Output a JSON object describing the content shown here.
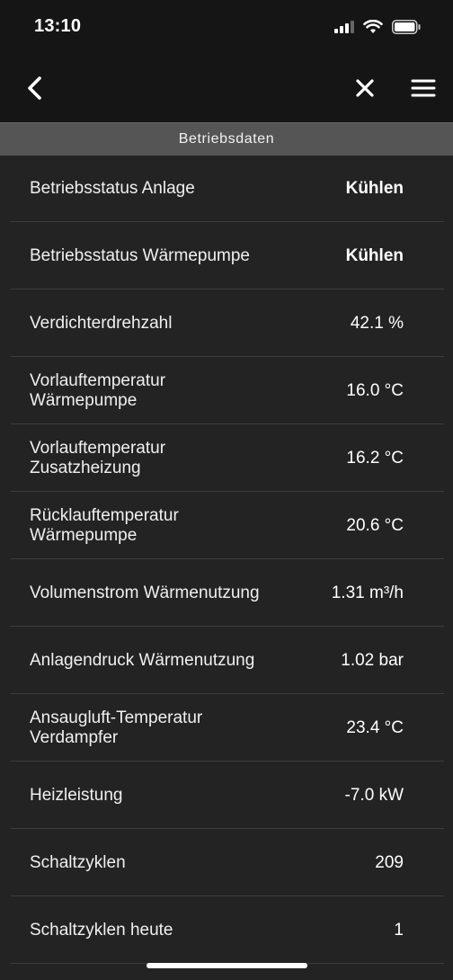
{
  "status_bar": {
    "time": "13:10",
    "icons": [
      "cellular-signal-icon",
      "wifi-icon",
      "battery-icon"
    ]
  },
  "nav": {
    "back_icon": "chevron-left-icon",
    "close_icon": "close-icon",
    "menu_icon": "hamburger-menu-icon"
  },
  "section": {
    "title": "Betriebsdaten"
  },
  "rows": [
    {
      "label": "Betriebsstatus Anlage",
      "value": "Kühlen",
      "bold": true
    },
    {
      "label": "Betriebsstatus Wärmepumpe",
      "value": "Kühlen",
      "bold": true
    },
    {
      "label": "Verdichterdrehzahl",
      "value": "42.1 %"
    },
    {
      "label": "Vorlauftemperatur\nWärmepumpe",
      "value": "16.0 °C"
    },
    {
      "label": "Vorlauftemperatur\nZusatzheizung",
      "value": "16.2 °C"
    },
    {
      "label": "Rücklauftemperatur\nWärmepumpe",
      "value": "20.6 °C"
    },
    {
      "label": "Volumenstrom Wärmenutzung",
      "value": "1.31 m³/h"
    },
    {
      "label": "Anlagendruck Wärmenutzung",
      "value": "1.02 bar"
    },
    {
      "label": "Ansaugluft-Temperatur\nVerdampfer",
      "value": "23.4 °C"
    },
    {
      "label": "Heizleistung",
      "value": "-7.0 kW"
    },
    {
      "label": "Schaltzyklen",
      "value": "209"
    },
    {
      "label": "Schaltzyklen heute",
      "value": "1"
    }
  ],
  "colors": {
    "background": "#232323",
    "bar": "#151515",
    "section_header": "#555555",
    "divider": "#3e3e3e",
    "text": "#ffffff"
  }
}
